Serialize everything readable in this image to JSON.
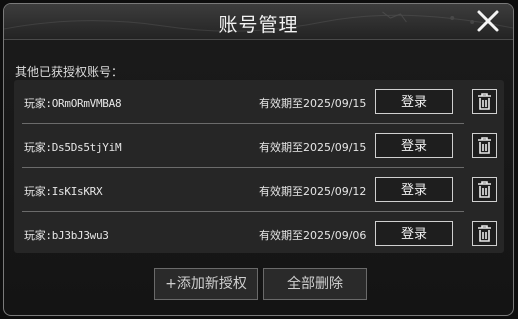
{
  "dialog": {
    "title": "账号管理",
    "subtitle": "其他已获授权账号："
  },
  "accounts": [
    {
      "account": "玩家:ORmORmVMBA8",
      "expiry": "有效期至2025/09/15",
      "login_label": "登录"
    },
    {
      "account": "玩家:Ds5Ds5tjYiM",
      "expiry": "有效期至2025/09/15",
      "login_label": "登录"
    },
    {
      "account": "玩家:IsKIsKRX",
      "expiry": "有效期至2025/09/12",
      "login_label": "登录"
    },
    {
      "account": "玩家:bJ3bJ3wu3",
      "expiry": "有效期至2025/09/06",
      "login_label": "登录"
    }
  ],
  "footer": {
    "add_label": "+添加新授权",
    "delete_all_label": "全部删除"
  },
  "icons": {
    "close": "close-icon",
    "trash": "trash-icon"
  }
}
